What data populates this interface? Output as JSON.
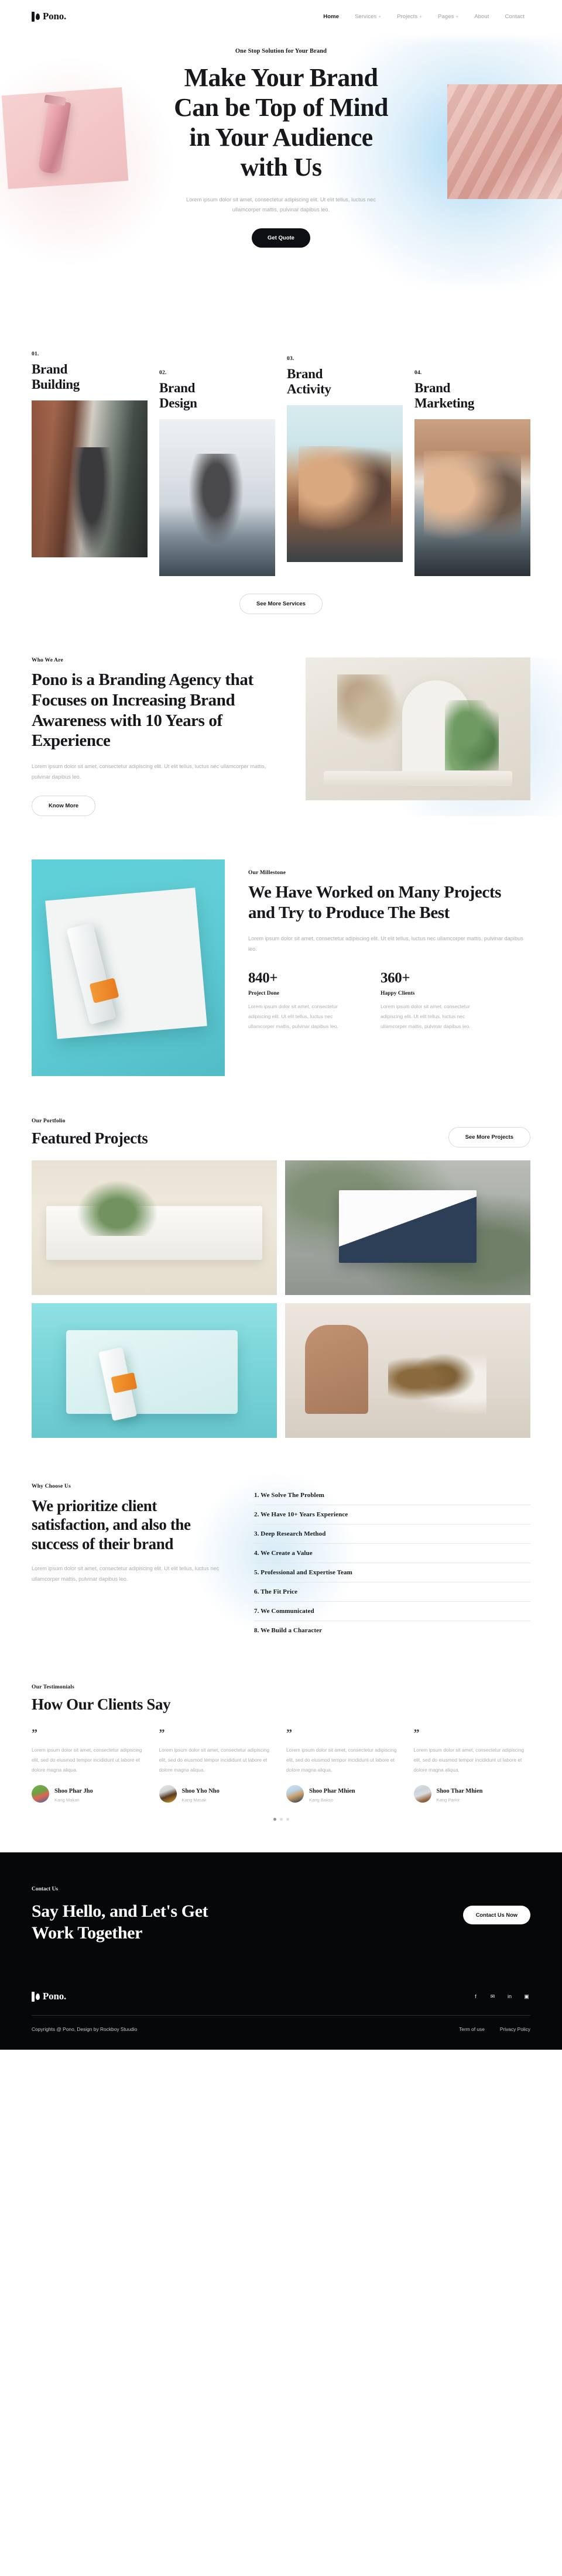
{
  "brand": {
    "name": "Pono."
  },
  "nav": {
    "items": [
      {
        "label": "Home",
        "active": true,
        "caret": false
      },
      {
        "label": "Services",
        "active": false,
        "caret": true
      },
      {
        "label": "Projects",
        "active": false,
        "caret": true
      },
      {
        "label": "Pages",
        "active": false,
        "caret": true
      },
      {
        "label": "About",
        "active": false,
        "caret": false
      },
      {
        "label": "Contact",
        "active": false,
        "caret": false
      }
    ],
    "caret_glyph": "+"
  },
  "hero": {
    "eyebrow": "One Stop Solution for Your Brand",
    "title_line1": "Make Your Brand",
    "title_line2": "Can be Top of Mind",
    "title_line3": "in Your Audience",
    "title_line4": "with Us",
    "subtitle": "Lorem ipsum dolor sit amet, consectetur adipiscing elit. Ut elit tellus, luctus nec ullamcorper mattis, pulvinar dapibus leo.",
    "cta_label": "Get Quote"
  },
  "services": {
    "items": [
      {
        "num": "01.",
        "title_line1": "Brand",
        "title_line2": "Building"
      },
      {
        "num": "02.",
        "title_line1": "Brand",
        "title_line2": "Design"
      },
      {
        "num": "03.",
        "title_line1": "Brand",
        "title_line2": "Activity"
      },
      {
        "num": "04.",
        "title_line1": "Brand",
        "title_line2": "Marketing"
      }
    ],
    "cta_label": "See More Services"
  },
  "about": {
    "label": "Who We Are",
    "title": "Pono is a Branding Agency that Focuses on Increasing Brand Awareness with 10 Years of Experience",
    "body": "Lorem ipsum dolor sit amet, consectetur adipiscing elit. Ut elit tellus, luctus nec ullamcorper mattis, pulvinar dapibus leo.",
    "cta_label": "Know More"
  },
  "milestone": {
    "label": "Our Millestone",
    "title": "We Have Worked on Many Projects and Try to Produce The Best",
    "body": "Lorem ipsum dolor sit amet, consectetur adipiscing elit. Ut elit tellus, luctus nec ullamcorper mattis, pulvinar dapibus leo.",
    "stats": [
      {
        "value": "840+",
        "label": "Project Done",
        "body": "Lorem ipsum dolor sit amet, consectetur adipiscing elit. Ut elit tellus, luctus nec ullamcorper mattis, pulvinar dapibus leo."
      },
      {
        "value": "360+",
        "label": "Happy Clients",
        "body": "Lorem ipsum dolor sit amet, consectetur adipiscing elit. Ut elit tellus, luctus nec ullamcorper mattis, pulvinar dapibus leo."
      }
    ]
  },
  "portfolio": {
    "label": "Our Portfolio",
    "title": "Featured Projects",
    "cta_label": "See More Projects"
  },
  "why": {
    "label": "Why Choose Us",
    "title": "We prioritize client satisfaction, and also the success of their brand",
    "body": "Lorem ipsum dolor sit amet, consectetur adipiscing elit. Ut elit tellus, luctus nec ullamcorper mattis, pulvinar dapibus leo.",
    "items": [
      "1. We Solve The Problem",
      "2. We Have 10+ Years Experience",
      "3. Deep Research Method",
      "4. We Create a Value",
      "5. Professional and Expertise Team",
      "6. The Fit Price",
      "7. We Communicated",
      "8. We Build a Character"
    ]
  },
  "testimonials": {
    "label": "Our Testimonials",
    "title": "How Our Clients Say",
    "quote_glyph": "”",
    "items": [
      {
        "text": "Lorem ipsum dolor sit amet, consectetur adipiscing elit, sed do eiusmod tempor incididunt ut labore et dolore magna aliqua.",
        "name": "Shoo Phar Jho",
        "role": "Kang Makan"
      },
      {
        "text": "Lorem ipsum dolor sit amet, consectetur adipiscing elit, sed do eiusmod tempor incididunt ut labore et dolore magna aliqua.",
        "name": "Shoo Yho Nho",
        "role": "Kang Masak"
      },
      {
        "text": "Lorem ipsum dolor sit amet, consectetur adipiscing elit, sed do eiusmod tempor incididunt ut labore et dolore magna aliqua.",
        "name": "Shoo Phar Mhien",
        "role": "Kang Bakso"
      },
      {
        "text": "Lorem ipsum dolor sit amet, consectetur adipiscing elit, sed do eiusmod tempor incididunt ut labore et dolore magna aliqua.",
        "name": "Shoo Thar Mhien",
        "role": "Kang Parkir"
      }
    ],
    "dots": [
      true,
      false,
      false
    ]
  },
  "cta": {
    "label": "Contact Us",
    "title_line1": "Say Hello, and Let's Get",
    "title_line2": "Work Together",
    "button_label": "Contact Us Now"
  },
  "footer": {
    "socials": [
      {
        "name": "facebook-icon",
        "glyph": "f"
      },
      {
        "name": "twitter-icon",
        "glyph": "✉"
      },
      {
        "name": "linkedin-icon",
        "glyph": "in"
      },
      {
        "name": "instagram-icon",
        "glyph": "▣"
      }
    ],
    "copyright": "Copyrights @ Pono, Design by Rockboy Stuudio",
    "links": [
      "Term of use",
      "Privacy Policy"
    ]
  },
  "colors": {
    "ink": "#14161a",
    "muted": "#a8adb1",
    "dark_bg": "#060708",
    "accent_blue": "#a9d9f5",
    "accent_pink": "#f3c6c6",
    "accent_teal": "#5fd0d8"
  }
}
